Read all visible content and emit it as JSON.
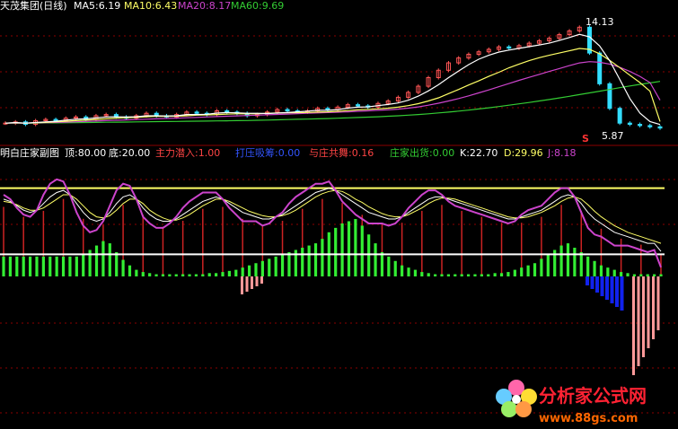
{
  "upper_panel": {
    "title": "天茂集团(日线)",
    "indicators": [
      {
        "key": "MA5",
        "label": "MA5:6.19",
        "color": "#ffffff"
      },
      {
        "key": "MA10",
        "label": "MA10:6.43",
        "color": "#ffff66"
      },
      {
        "key": "MA20",
        "label": "MA20:8.17",
        "color": "#cc44cc"
      },
      {
        "key": "MA60",
        "label": "MA60:9.69",
        "color": "#33cc33"
      }
    ],
    "high_label": "14.13",
    "low_label": "5.87",
    "signal_glyph": "S"
  },
  "lower_panel": {
    "title": "明白庄家副图",
    "indicators": [
      {
        "label": "顶:80.00",
        "color": "#ffffff"
      },
      {
        "label": "底:20.00",
        "color": "#ffffff"
      },
      {
        "label": "主力潜入:1.00",
        "color": "#ff4444"
      },
      {
        "label": "打压吸筹:0.00",
        "color": "#3355ff"
      },
      {
        "label": "与庄共舞:0.16",
        "color": "#ff4444"
      },
      {
        "label": "庄家出货:0.00",
        "color": "#33cc33"
      },
      {
        "label": "K:22.70",
        "color": "#ffffff"
      },
      {
        "label": "D:29.96",
        "color": "#ffff66"
      },
      {
        "label": "J:8.18",
        "color": "#cc44cc"
      }
    ]
  },
  "watermark": {
    "main": "分析家公式网",
    "url": "www.88gs.com"
  },
  "colors": {
    "up": "#ff5555",
    "down": "#33ddff",
    "ma5": "#ffffff",
    "ma10": "#ffff66",
    "ma20": "#cc44cc",
    "ma60": "#33cc33",
    "green_bar": "#33ee33",
    "red_bar": "#cc2222",
    "blue_bar": "#1122ee",
    "pink_bar": "#ff9999",
    "grid": "#8b0000",
    "top_line": "#ffff66",
    "bottom_line": "#ffffff",
    "j_line": "#cc44cc"
  },
  "chart_data": [
    {
      "type": "line",
      "name": "price",
      "title": "天茂集团(日线)",
      "close": [
        6.3,
        6.4,
        6.2,
        6.5,
        6.6,
        6.5,
        6.7,
        6.8,
        6.6,
        6.9,
        7.0,
        6.8,
        6.7,
        6.9,
        7.1,
        6.9,
        6.8,
        7.0,
        7.2,
        7.1,
        7.0,
        7.3,
        7.2,
        7.1,
        6.9,
        7.0,
        7.2,
        7.4,
        7.3,
        7.2,
        7.3,
        7.5,
        7.4,
        7.6,
        7.8,
        7.7,
        7.6,
        7.9,
        8.1,
        8.4,
        8.8,
        9.3,
        10.0,
        10.6,
        11.2,
        11.6,
        11.9,
        12.1,
        12.3,
        12.5,
        12.4,
        12.6,
        12.8,
        13.0,
        13.2,
        13.5,
        13.8,
        14.1,
        12.0,
        9.5,
        7.5,
        6.3,
        6.2,
        6.1,
        6.0,
        5.9
      ],
      "ma5": [
        6.3,
        6.35,
        6.3,
        6.35,
        6.4,
        6.45,
        6.55,
        6.62,
        6.65,
        6.72,
        6.8,
        6.82,
        6.8,
        6.82,
        6.9,
        6.9,
        6.88,
        6.9,
        7.0,
        7.0,
        7.02,
        7.12,
        7.16,
        7.14,
        7.1,
        7.1,
        7.08,
        7.12,
        7.16,
        7.22,
        7.28,
        7.34,
        7.34,
        7.4,
        7.52,
        7.6,
        7.62,
        7.72,
        7.82,
        7.94,
        8.16,
        8.5,
        8.92,
        9.42,
        10.0,
        10.54,
        11.06,
        11.5,
        11.82,
        12.08,
        12.24,
        12.38,
        12.52,
        12.66,
        12.8,
        13.02,
        13.26,
        13.52,
        13.32,
        12.58,
        11.38,
        9.86,
        8.3,
        7.12,
        6.42,
        6.19
      ],
      "ma10": [
        6.3,
        6.33,
        6.3,
        6.33,
        6.36,
        6.4,
        6.45,
        6.5,
        6.54,
        6.6,
        6.65,
        6.7,
        6.74,
        6.77,
        6.82,
        6.86,
        6.85,
        6.86,
        6.9,
        6.95,
        6.97,
        7.0,
        7.04,
        7.06,
        7.07,
        7.06,
        7.1,
        7.13,
        7.14,
        7.15,
        7.17,
        7.2,
        7.22,
        7.26,
        7.32,
        7.38,
        7.42,
        7.46,
        7.52,
        7.6,
        7.72,
        7.88,
        8.1,
        8.36,
        8.7,
        9.04,
        9.4,
        9.74,
        10.1,
        10.44,
        10.8,
        11.1,
        11.38,
        11.62,
        11.82,
        12.0,
        12.18,
        12.37,
        12.3,
        11.94,
        11.4,
        10.82,
        10.2,
        9.6,
        8.9,
        6.43
      ],
      "ma20": [
        6.3,
        6.31,
        6.31,
        6.32,
        6.34,
        6.36,
        6.38,
        6.41,
        6.44,
        6.47,
        6.5,
        6.53,
        6.56,
        6.59,
        6.62,
        6.65,
        6.68,
        6.71,
        6.74,
        6.77,
        6.8,
        6.83,
        6.86,
        6.89,
        6.92,
        6.95,
        6.98,
        7.01,
        7.04,
        7.07,
        7.1,
        7.13,
        7.16,
        7.19,
        7.22,
        7.26,
        7.3,
        7.34,
        7.38,
        7.44,
        7.52,
        7.62,
        7.76,
        7.92,
        8.1,
        8.3,
        8.52,
        8.76,
        9.0,
        9.26,
        9.52,
        9.78,
        10.02,
        10.26,
        10.5,
        10.74,
        10.98,
        11.2,
        11.3,
        11.25,
        11.1,
        10.85,
        10.5,
        10.1,
        9.6,
        8.17
      ],
      "ma60": [
        6.3,
        6.3,
        6.31,
        6.31,
        6.32,
        6.32,
        6.33,
        6.34,
        6.35,
        6.36,
        6.37,
        6.38,
        6.39,
        6.4,
        6.41,
        6.42,
        6.43,
        6.44,
        6.45,
        6.46,
        6.47,
        6.48,
        6.49,
        6.5,
        6.51,
        6.53,
        6.55,
        6.57,
        6.59,
        6.61,
        6.63,
        6.65,
        6.67,
        6.7,
        6.73,
        6.76,
        6.79,
        6.82,
        6.86,
        6.9,
        6.95,
        7.0,
        7.06,
        7.13,
        7.2,
        7.28,
        7.36,
        7.45,
        7.55,
        7.65,
        7.76,
        7.87,
        7.98,
        8.1,
        8.22,
        8.35,
        8.48,
        8.62,
        8.76,
        8.9,
        9.04,
        9.18,
        9.32,
        9.45,
        9.57,
        9.69
      ]
    },
    {
      "type": "bar",
      "name": "zhuangjia",
      "title": "明白庄家副图",
      "ylim": [
        -100,
        100
      ],
      "reference_lines": [
        80,
        20
      ],
      "green_bars": [
        18,
        18,
        18,
        18,
        18,
        18,
        18,
        18,
        18,
        18,
        18,
        18,
        20,
        24,
        28,
        32,
        30,
        22,
        15,
        10,
        6,
        4,
        3,
        2,
        2,
        2,
        2,
        2,
        2,
        2,
        2,
        3,
        3,
        4,
        5,
        6,
        8,
        10,
        12,
        14,
        16,
        18,
        20,
        22,
        24,
        26,
        28,
        30,
        34,
        40,
        44,
        48,
        50,
        52,
        46,
        38,
        30,
        22,
        18,
        14,
        10,
        8,
        6,
        4,
        3,
        2,
        2,
        2,
        2,
        2,
        2,
        2,
        2,
        2,
        3,
        3,
        4,
        6,
        8,
        10,
        12,
        16,
        20,
        24,
        28,
        30,
        26,
        22,
        18,
        14,
        10,
        8,
        6,
        4,
        3,
        2,
        2,
        2,
        2,
        2
      ],
      "red_bars": [
        0,
        0,
        0,
        0,
        0,
        0,
        0,
        0,
        0,
        0,
        0,
        0,
        0,
        0,
        0,
        0,
        0,
        0,
        0,
        0,
        0,
        0,
        0,
        0,
        0,
        0,
        0,
        0,
        0,
        0,
        0,
        0,
        0,
        0,
        0,
        0,
        0,
        0,
        0,
        0,
        0,
        0,
        0,
        0,
        0,
        0,
        0,
        0,
        0,
        0,
        0,
        0,
        0,
        0,
        0,
        0,
        0,
        0,
        0,
        0,
        0,
        0,
        0,
        0,
        0,
        0,
        0,
        0,
        0,
        0,
        0,
        0,
        0,
        0,
        0,
        0,
        0,
        0,
        0,
        0,
        0,
        0,
        0,
        0,
        0,
        0,
        0,
        0,
        0,
        0,
        0,
        0,
        0,
        0,
        0,
        0,
        0,
        0,
        0,
        0
      ],
      "k": [
        70,
        68,
        64,
        60,
        58,
        60,
        66,
        72,
        76,
        78,
        74,
        66,
        58,
        52,
        50,
        52,
        58,
        66,
        72,
        74,
        70,
        62,
        56,
        52,
        50,
        50,
        52,
        56,
        60,
        64,
        68,
        70,
        72,
        70,
        66,
        62,
        58,
        56,
        54,
        52,
        52,
        54,
        56,
        60,
        64,
        68,
        72,
        76,
        78,
        80,
        78,
        74,
        70,
        66,
        62,
        58,
        56,
        54,
        52,
        52,
        54,
        58,
        62,
        66,
        70,
        72,
        72,
        70,
        68,
        66,
        64,
        62,
        60,
        58,
        56,
        54,
        52,
        52,
        54,
        56,
        58,
        60,
        64,
        68,
        72,
        74,
        72,
        66,
        58,
        52,
        48,
        44,
        40,
        38,
        36,
        34,
        32,
        30,
        30,
        22.7
      ],
      "d": [
        68,
        67,
        65,
        62,
        60,
        60,
        62,
        66,
        70,
        74,
        74,
        70,
        64,
        58,
        54,
        53,
        55,
        60,
        66,
        70,
        70,
        66,
        60,
        56,
        53,
        51,
        51,
        53,
        56,
        60,
        64,
        67,
        70,
        70,
        68,
        65,
        62,
        59,
        57,
        55,
        54,
        54,
        55,
        57,
        60,
        64,
        68,
        72,
        75,
        77,
        78,
        77,
        74,
        70,
        67,
        63,
        60,
        57,
        55,
        54,
        54,
        56,
        59,
        62,
        66,
        69,
        71,
        71,
        70,
        68,
        66,
        64,
        62,
        60,
        58,
        56,
        54,
        53,
        53,
        54,
        56,
        58,
        61,
        64,
        68,
        71,
        72,
        70,
        65,
        59,
        54,
        50,
        46,
        43,
        40,
        38,
        36,
        34,
        32,
        29.96
      ],
      "j": [
        74,
        70,
        62,
        56,
        54,
        60,
        74,
        84,
        88,
        86,
        74,
        58,
        46,
        40,
        42,
        50,
        64,
        78,
        84,
        82,
        70,
        54,
        48,
        44,
        44,
        48,
        54,
        62,
        68,
        72,
        76,
        76,
        76,
        70,
        62,
        56,
        50,
        50,
        50,
        46,
        48,
        54,
        58,
        66,
        72,
        76,
        80,
        84,
        84,
        86,
        78,
        68,
        62,
        56,
        52,
        48,
        48,
        48,
        46,
        48,
        54,
        62,
        68,
        74,
        78,
        78,
        74,
        68,
        64,
        62,
        60,
        58,
        56,
        54,
        52,
        50,
        48,
        50,
        56,
        60,
        62,
        64,
        70,
        76,
        80,
        80,
        72,
        58,
        44,
        38,
        36,
        32,
        28,
        28,
        28,
        26,
        24,
        22,
        24,
        8.18
      ]
    }
  ]
}
